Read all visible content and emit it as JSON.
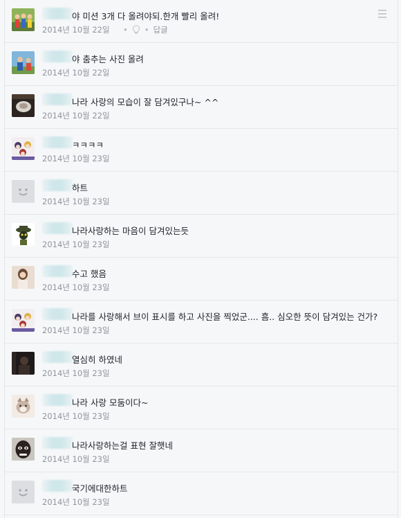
{
  "comments": [
    {
      "avatar": "photo-group",
      "message": "야 미션 3개 다 올려야되.한개 빨리 올려!",
      "date": "2014년 10월 22일",
      "reply_label": "답글",
      "show_actions": true
    },
    {
      "avatar": "photo-outdoor",
      "message": "야 춤추는 사진 올려",
      "date": "2014년 10월 22일"
    },
    {
      "avatar": "photo-dark-object",
      "message": "나라 사랑의 모습이 잘 담겨있구나~ ^^",
      "date": "2014년 10월 22일"
    },
    {
      "avatar": "photo-anime",
      "message": "ㅋㅋㅋㅋ",
      "date": "2014년 10월 23일"
    },
    {
      "avatar": "default-face",
      "message": "하트",
      "date": "2014년 10월 23일"
    },
    {
      "avatar": "photo-cartoon-hat",
      "message": "나라사랑하는 마음이 담겨있는듯",
      "date": "2014년 10월 23일"
    },
    {
      "avatar": "photo-girl",
      "message": "수고 했음",
      "date": "2014년 10월 23일"
    },
    {
      "avatar": "photo-anime",
      "message": "나라를 사랑해서 브이 표시를 하고 사진을 찍었군.... 흠.. 심오한 뜻이 담겨있는 건가?",
      "date": "2014년 10월 23일"
    },
    {
      "avatar": "photo-dark",
      "message": "열심히 하였네",
      "date": "2014년 10월 23일"
    },
    {
      "avatar": "photo-cat",
      "message": "나라 사랑 모둠이다~",
      "date": "2014년 10월 23일"
    },
    {
      "avatar": "photo-face",
      "message": "나라사랑하는걸 표현 잘햇네",
      "date": "2014년 10월 23일"
    },
    {
      "avatar": "default-face",
      "message": "국기에대한하트",
      "date": "2014년 10월 23일"
    }
  ]
}
